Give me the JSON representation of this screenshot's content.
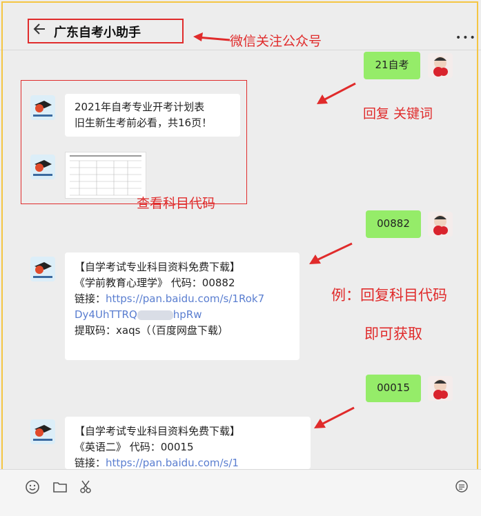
{
  "header": {
    "title": "广东自考小助手"
  },
  "annotations": {
    "follow": "微信关注公众号",
    "reply_keyword": "回复 关键词",
    "view_code": "查看科目代码",
    "example": "例：回复科目代码",
    "get": "即可获取"
  },
  "messages": {
    "m1": {
      "text": "21自考"
    },
    "m2": {
      "line1": "2021年自考专业开考计划表",
      "line2": "旧生新生考前必看，共16页！"
    },
    "m3": {
      "text": "00882"
    },
    "m4": {
      "title": "【自学考试专业科目资料免费下载】",
      "subject": "《学前教育心理学》 代码：00882",
      "link_label": "链接：",
      "link_part1": "https://pan.baidu.com/s/1Rok7",
      "link_part2": "Dy4UhTTRQ",
      "link_part3": "hpRw",
      "code": "提取码：xaqs（（百度网盘下载）"
    },
    "m5": {
      "text": "00015"
    },
    "m6": {
      "title": "【自学考试专业科目资料免费下载】",
      "subject": "《英语二》 代码：00015",
      "link_label": "链接：",
      "link_part1": "https://pan.baidu.com/s/1"
    }
  },
  "colors": {
    "accent_red": "#e02b2b",
    "bubble_green": "#95ec69",
    "link": "#5a7ed0",
    "frame": "#f5c542"
  }
}
